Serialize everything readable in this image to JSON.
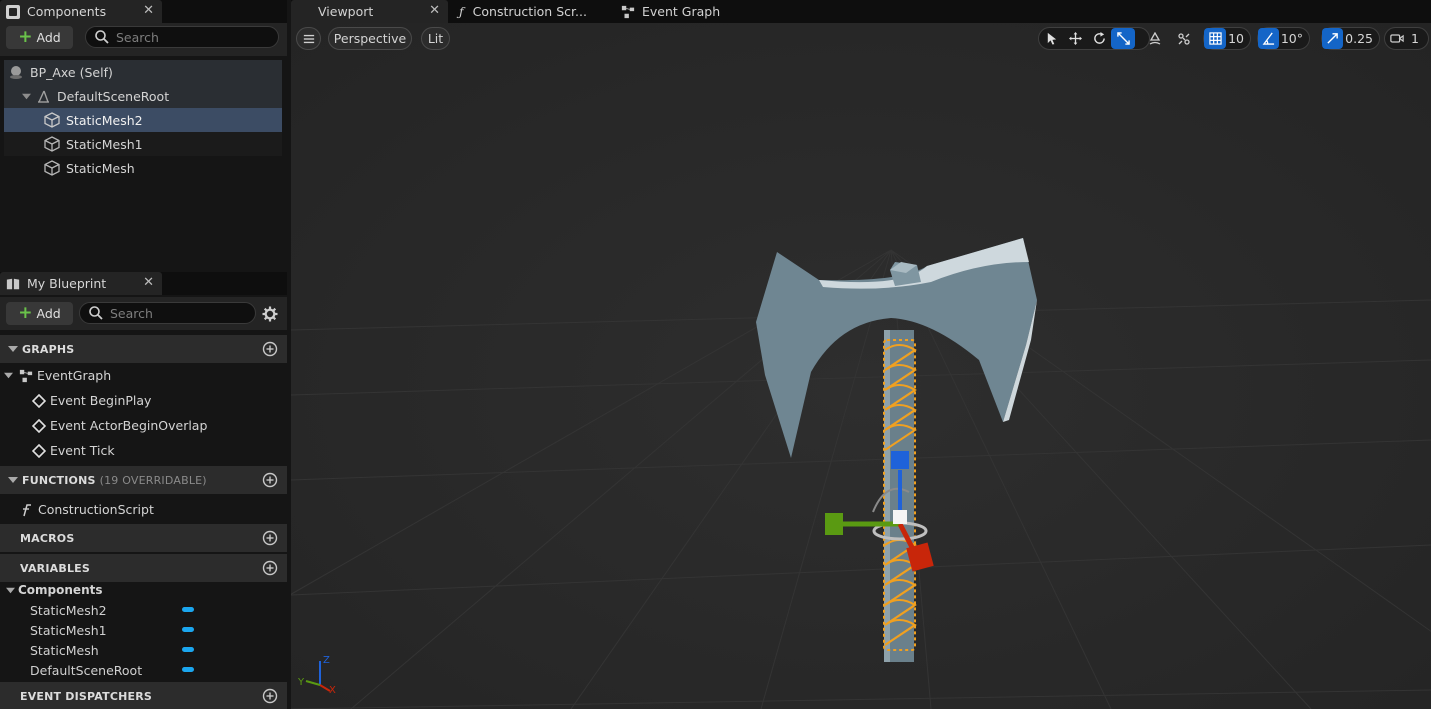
{
  "components_panel": {
    "tab_label": "Components",
    "add_label": "Add",
    "search_placeholder": "Search",
    "tree": [
      {
        "label": "BP_Axe (Self)"
      },
      {
        "label": "DefaultSceneRoot"
      },
      {
        "label": "StaticMesh2"
      },
      {
        "label": "StaticMesh1"
      },
      {
        "label": "StaticMesh"
      }
    ]
  },
  "blueprint_panel": {
    "tab_label": "My Blueprint",
    "add_label": "Add",
    "search_placeholder": "Search",
    "graphs_header": "GRAPHS",
    "event_graph_label": "EventGraph",
    "events": [
      "Event BeginPlay",
      "Event ActorBeginOverlap",
      "Event Tick"
    ],
    "functions_header": "FUNCTIONS",
    "functions_sub": "(19 OVERRIDABLE)",
    "function_items": [
      "ConstructionScript"
    ],
    "macros_header": "MACROS",
    "variables_header": "VARIABLES",
    "variable_category": "Components",
    "variables": [
      "StaticMesh2",
      "StaticMesh1",
      "StaticMesh",
      "DefaultSceneRoot"
    ],
    "dispatchers_header": "EVENT DISPATCHERS"
  },
  "viewport": {
    "tabs": {
      "viewport": "Viewport",
      "construction": "Construction Scr...",
      "event_graph": "Event Graph"
    },
    "perspective_label": "Perspective",
    "lit_label": "Lit",
    "grid_snap": "10",
    "rotation_snap": "10°",
    "scale_snap": "0.25",
    "camera_speed": "1",
    "axis_labels": {
      "x": "X",
      "y": "Y",
      "z": "Z"
    }
  },
  "colors": {
    "accent_blue": "#1465c7",
    "variable_pill": "#1ba6ee",
    "add_plus": "#6ac24a",
    "gizmo_x": "#c8260a",
    "gizmo_y": "#5a9a12",
    "gizmo_z": "#1f62d9",
    "wrap_highlight": "#f0a020"
  },
  "icons": [
    "components-icon",
    "search-icon",
    "actor-icon",
    "scene-root-icon",
    "static-mesh-icon",
    "blueprint-icon",
    "settings-icon",
    "graph-icon",
    "event-icon",
    "function-icon",
    "add-circle-icon",
    "menu-icon",
    "select-icon",
    "translate-icon",
    "rotate-icon",
    "scale-icon",
    "surface-snap-icon",
    "world-local-icon",
    "grid-icon",
    "angle-icon",
    "scale-snap-icon",
    "camera-icon"
  ]
}
